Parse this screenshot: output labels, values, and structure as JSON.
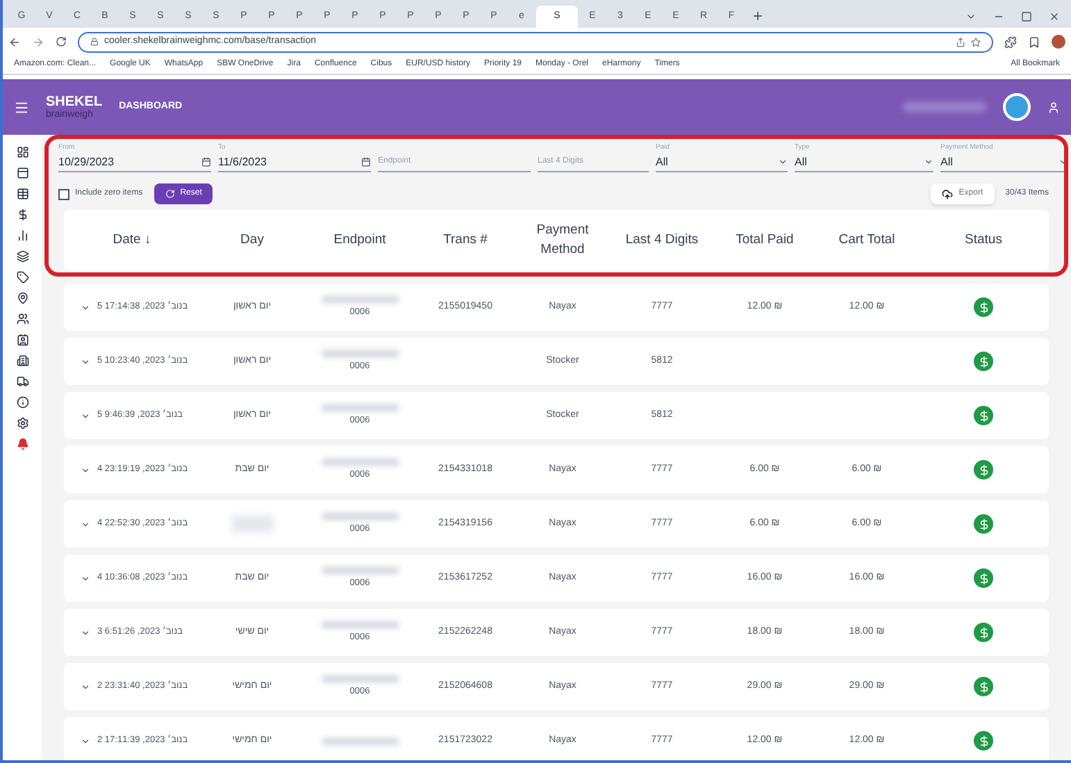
{
  "browser": {
    "tabs": [
      {
        "label": "G",
        "selected": false
      },
      {
        "label": "V",
        "selected": false
      },
      {
        "label": "C",
        "selected": false
      },
      {
        "label": "B",
        "selected": false
      },
      {
        "label": "S",
        "selected": false
      },
      {
        "label": "S",
        "selected": false
      },
      {
        "label": "S",
        "selected": false
      },
      {
        "label": "S",
        "selected": false
      },
      {
        "label": "P",
        "selected": false
      },
      {
        "label": "P",
        "selected": false
      },
      {
        "label": "P",
        "selected": false
      },
      {
        "label": "P",
        "selected": false
      },
      {
        "label": "P",
        "selected": false
      },
      {
        "label": "P",
        "selected": false
      },
      {
        "label": "P",
        "selected": false
      },
      {
        "label": "P",
        "selected": false
      },
      {
        "label": "P",
        "selected": false
      },
      {
        "label": "P",
        "selected": false
      },
      {
        "label": "e",
        "selected": false
      },
      {
        "label": "S",
        "selected": true
      },
      {
        "label": "E",
        "selected": false
      },
      {
        "label": "3",
        "selected": false
      },
      {
        "label": "E",
        "selected": false
      },
      {
        "label": "E",
        "selected": false
      },
      {
        "label": "R",
        "selected": false
      },
      {
        "label": "F",
        "selected": false
      }
    ],
    "url": "cooler.shekelbrainweighmc.com/base/transaction",
    "bookmarks": [
      "Amazon.com: Clean...",
      "Google UK",
      "WhatsApp",
      "SBW OneDrive",
      "Jira",
      "Confluence",
      "Cibus",
      "EUR/USD history",
      "Priority 19",
      "Monday - Orel",
      "eHarmony",
      "Timers"
    ],
    "all_bookmarks": "All Bookmark"
  },
  "header": {
    "logo": "SHEKEL",
    "logo_sub": "brainweigh",
    "title": "DASHBOARD"
  },
  "filters": [
    {
      "kind": "date",
      "label": "From",
      "value": "10/29/2023"
    },
    {
      "kind": "date",
      "label": "To",
      "value": "11/6/2023"
    },
    {
      "kind": "text",
      "placeholder": "Endpoint"
    },
    {
      "kind": "text",
      "placeholder": "Last 4 Digits"
    },
    {
      "kind": "select",
      "label": "Paid",
      "value": "All"
    },
    {
      "kind": "select",
      "label": "Type",
      "value": "All"
    },
    {
      "kind": "select",
      "label": "Payment Method",
      "value": "All"
    }
  ],
  "include_zero": {
    "label": "Include zero items",
    "checked": false
  },
  "reset_button": "Reset",
  "export_button": "Export",
  "item_count": "30/43 Items",
  "table": {
    "columns": [
      {
        "label": "Date ↓"
      },
      {
        "label": "Day"
      },
      {
        "label": "Endpoint"
      },
      {
        "label": "Trans #"
      },
      {
        "label": "Payment Method"
      },
      {
        "label": "Last 4 Digits"
      },
      {
        "label": "Total Paid"
      },
      {
        "label": "Cart Total"
      },
      {
        "label": "Status"
      }
    ],
    "rows": [
      {
        "date": "5 17:14:38 ,2023 בנוב׳",
        "day": "יום ראשון",
        "endpoint": "0006",
        "trans": "2155019450",
        "method": "Nayax",
        "last4": "7777",
        "total_paid": "12.00 ₪",
        "cart_total": "12.00 ₪",
        "paid": true
      },
      {
        "date": "5 10:23:40 ,2023 בנוב׳",
        "day": "יום ראשון",
        "endpoint": "0006",
        "method": "Stocker",
        "last4": "5812",
        "paid": true
      },
      {
        "date": "5 9:46:39 ,2023 בנוב׳",
        "day": "יום ראשון",
        "endpoint": "0006",
        "method": "Stocker",
        "last4": "5812",
        "paid": true
      },
      {
        "date": "4 23:19:19 ,2023 בנוב׳",
        "day": "יום שבת",
        "endpoint": "0006",
        "trans": "2154331018",
        "method": "Nayax",
        "last4": "7777",
        "total_paid": "6.00 ₪",
        "cart_total": "6.00 ₪",
        "paid": true
      },
      {
        "date": "4 22:52:30 ,2023 בנוב׳",
        "endpoint": "0006",
        "trans": "2154319156",
        "method": "Nayax",
        "last4": "7777",
        "total_paid": "6.00 ₪",
        "cart_total": "6.00 ₪",
        "paid": true
      },
      {
        "date": "4 10:36:08 ,2023 בנוב׳",
        "day": "יום שבת",
        "endpoint": "0006",
        "trans": "2153617252",
        "method": "Nayax",
        "last4": "7777",
        "total_paid": "16.00 ₪",
        "cart_total": "16.00 ₪",
        "paid": true
      },
      {
        "date": "3 6:51:26 ,2023 בנוב׳",
        "day": "יום שישי",
        "endpoint": "0006",
        "trans": "2152262248",
        "method": "Nayax",
        "last4": "7777",
        "total_paid": "18.00 ₪",
        "cart_total": "18.00 ₪",
        "paid": true
      },
      {
        "date": "2 23:31:40 ,2023 בנוב׳",
        "day": "יום חמישי",
        "endpoint": "0006",
        "trans": "2152064608",
        "method": "Nayax",
        "last4": "7777",
        "total_paid": "29.00 ₪",
        "cart_total": "29.00 ₪",
        "paid": true
      },
      {
        "date": "2 17:11:39 ,2023 בנוב׳",
        "day": "יום חמישי",
        "trans": "2151723022",
        "method": "Nayax",
        "last4": "7777",
        "total_paid": "12.00 ₪",
        "cart_total": "12.00 ₪",
        "paid": true
      }
    ]
  }
}
